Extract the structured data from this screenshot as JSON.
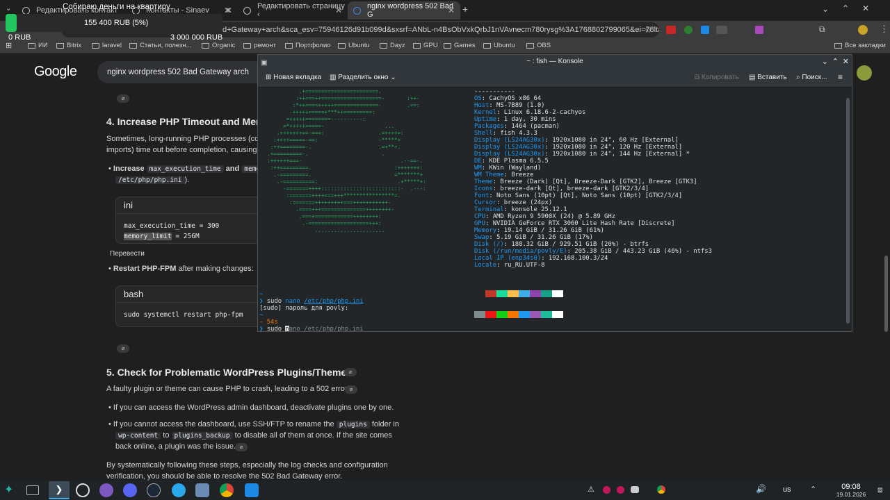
{
  "tabs": [
    {
      "title": "Редактировать контакт",
      "active": false
    },
    {
      "title": "Контакты - Sinaev",
      "active": false
    },
    {
      "title": "Редактировать страницу ‹",
      "active": false
    },
    {
      "title": "nginx wordpress 502 Bad G",
      "active": true
    }
  ],
  "widget": {
    "title": "Собираю деньги на квартиру",
    "current": "155 400 RUB (5%)",
    "min": "0 RUB",
    "max": "3 000 000 RUB",
    "progress": 0.05
  },
  "omnibox": {
    "url": "d+Gateway+arch&sca_esv=75946126d91b099d&sxsrf=ANbL-n4BsObVxkQrbJ1nVAvnecm780rysg%3A1768802799065&ei=78ltafnVA5u..."
  },
  "bookmarks": [
    "ИИ",
    "Bitrix",
    "laravel",
    "Статьи, полезн...",
    "Organic",
    "ремонт",
    "Портфолио",
    "Ubuntu",
    "Dayz",
    "GPU",
    "Games",
    "Ubuntu",
    "OBS"
  ],
  "bookmarks_all": "Все закладки",
  "page": {
    "logo": "Google",
    "query": "nginx wordpress 502 Bad Gateway arch",
    "h_php": "4. Increase PHP Timeout and Mem",
    "p_php_1": "Sometimes, long-running PHP processes (cor",
    "p_php_2": "imports) time out before completion, causing a",
    "li_increase_bold": "Increase",
    "li_increase_code1": "max_execution_time",
    "li_increase_and": "and",
    "li_increase_code2": "memo",
    "li_increase_path": "/etc/php/php.ini",
    "li_increase_end": ").",
    "ini_lang": "ini",
    "ini_line1": "max_execution_time = 300",
    "ini_line2_sel": "memory_limit",
    "ini_line2_rest": " = 256M",
    "translate": "Перевести",
    "restart_bold": "Restart PHP-FPM",
    "restart_rest": " after making changes:",
    "bash_lang": "bash",
    "bash_line": "sudo systemctl restart php-fpm",
    "h_plugins": "5. Check for Problematic WordPress Plugins/Themes",
    "p_plugins": "A faulty plugin or theme can cause PHP to crash, leading to a 502 error.",
    "li_admin": "If you can access the WordPress admin dashboard, deactivate plugins one by one.",
    "li_ftp_1": "If you cannot access the dashboard, use SSH/FTP to rename the",
    "li_ftp_code1": "plugins",
    "li_ftp_2": "folder in",
    "li_ftp_code2": "wp-content",
    "li_ftp_to": "to",
    "li_ftp_code3": "plugins_backup",
    "li_ftp_3": "to disable all of them at once. If the site comes",
    "li_ftp_4": "back online, a plugin was the issue.",
    "p_final_1": "By systematically following these steps, especially the log checks and configuration",
    "p_final_2": "verification, you should be able to resolve the 502 Bad Gateway error."
  },
  "konsole": {
    "title": "~ : fish — Konsole",
    "new_tab": "Новая вкладка",
    "split": "Разделить окно",
    "copy": "Копировать",
    "paste": "Вставить",
    "search": "Поиск...",
    "fetch": [
      {
        "k": "",
        "v": "-----------"
      },
      {
        "k": "OS",
        "v": ": CachyOS x86_64"
      },
      {
        "k": "Host",
        "v": ": MS-7B89 (1.0)"
      },
      {
        "k": "Kernel",
        "v": ": Linux 6.18.6-2-cachyos"
      },
      {
        "k": "Uptime",
        "v": ": 1 day, 30 mins"
      },
      {
        "k": "Packages",
        "v": ": 1464 (pacman)"
      },
      {
        "k": "Shell",
        "v": ": fish 4.3.3"
      },
      {
        "k": "Display (LS24AG30x)",
        "v": ": 1920x1080 in 24\", 60 Hz [External]"
      },
      {
        "k": "Display (LS24AG30x)",
        "v": ": 1920x1080 in 24\", 120 Hz [External]"
      },
      {
        "k": "Display (LS24AG30x)",
        "v": ": 1920x1080 in 24\", 144 Hz [External] *"
      },
      {
        "k": "DE",
        "v": ": KDE Plasma 6.5.5"
      },
      {
        "k": "WM",
        "v": ": KWin (Wayland)"
      },
      {
        "k": "WM Theme",
        "v": ": Breeze"
      },
      {
        "k": "Theme",
        "v": ": Breeze (Dark) [Qt], Breeze-Dark [GTK2], Breeze [GTK3]"
      },
      {
        "k": "Icons",
        "v": ": breeze-dark [Qt], breeze-dark [GTK2/3/4]"
      },
      {
        "k": "Font",
        "v": ": Noto Sans (10pt) [Qt], Noto Sans (10pt) [GTK2/3/4]"
      },
      {
        "k": "Cursor",
        "v": ": breeze (24px)"
      },
      {
        "k": "Terminal",
        "v": ": konsole 25.12.1"
      },
      {
        "k": "CPU",
        "v": ": AMD Ryzen 9 5900X (24) @ 5.89 GHz"
      },
      {
        "k": "GPU",
        "v": ": NVIDIA GeForce RTX 3060 Lite Hash Rate [Discrete]"
      },
      {
        "k": "Memory",
        "v": ": 19.14 GiB / 31.26 GiB (61%)"
      },
      {
        "k": "Swap",
        "v": ": 5.19 GiB / 31.26 GiB (17%)"
      },
      {
        "k": "Disk (/)",
        "v": ": 188.32 GiB / 929.51 GiB (20%) - btrfs"
      },
      {
        "k": "Disk (/run/media/povly/E)",
        "v": ": 205.38 GiB / 443.23 GiB (46%) - ntfs3"
      },
      {
        "k": "Local IP (enp34s0)",
        "v": ": 192.168.100.3/24"
      },
      {
        "k": "Locale",
        "v": ": ru_RU.UTF-8"
      }
    ],
    "ascii": [
      "            .+=======================.",
      "           :++===++===================-       :++-",
      "          :*++====+++++==============-        .==:",
      "         -+++++=====+***++=========:",
      "        =+++++========----------:",
      "       =*+++++=====-                   ...",
      "     .+++++++==-===:                 .=++++=:",
      "    :++++=====-==:                   -*****+",
      "   :++========-.                     .=+**+.",
      "  .+=========-.                       .",
      "  :++++++===-                               .--==-.",
      "   :++=========.                          :+++++++:",
      "    .-=========.                          =*******+",
      "     .-==========:                         .+*****+:",
      "       -=======++++:::::::::::::::::::::::::-  .---:",
      "        :=======++++===+++****************=.",
      "         :=======+++++++++===+++++++++++-",
      "           .====+++==============++++++++-",
      "            .===+============++++++++:",
      "             .-===================+++:",
      "                 ......................"
    ],
    "cmd1_prompt": "❯ ",
    "cmd1": "sudo nano /etc/php/php.ini",
    "cmd1_sudo": "sudo ",
    "cmd1_nano": "nano ",
    "cmd1_path": "/etc/php/php.ini",
    "sudo_prompt": "[sudo] пароль для povly:",
    "duration": "- 54s",
    "cmd2_sudo": "sudo ",
    "cmd2_cursor": "n",
    "cmd2_rest": "ano /etc/php/php.ini",
    "tilde": "~",
    "palette": [
      "#7f8c8d",
      "#ed1515",
      "#11d116",
      "#f67400",
      "#1d99f3",
      "#9b59b6",
      "#1abc9c",
      "#fcfcfc"
    ],
    "palette_top": [
      "#232629",
      "#c0392b",
      "#1cdc9a",
      "#fdbc4b",
      "#3daee9",
      "#8e44ad",
      "#16a085",
      "#ffffff"
    ]
  },
  "taskbar": {
    "keyboard": "us",
    "time": "09:08",
    "date": "19.01.2026"
  },
  "colors": {
    "accent": "#1d99f3",
    "terminal_green": "#27ae60",
    "progress_green": "#22c55e"
  }
}
